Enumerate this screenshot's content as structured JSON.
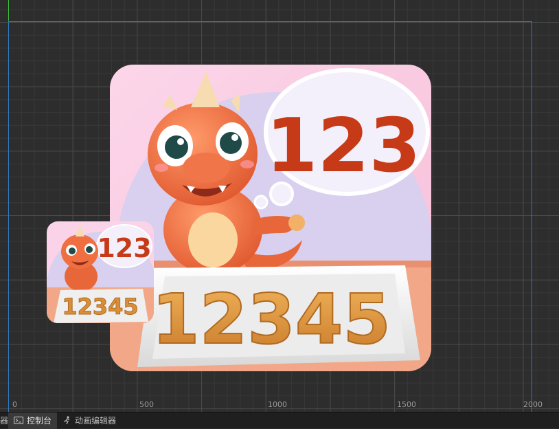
{
  "ruler": {
    "labels": [
      "0",
      "500",
      "1000",
      "1500",
      "2000"
    ]
  },
  "preview": {
    "thought_number": "123",
    "plate_digits": "12345"
  },
  "bottom_tabs": {
    "partial_label": "器",
    "console_label": "控制台",
    "animation_editor_label": "动画编辑器"
  },
  "colors": {
    "canvas_bg": "#2d2d2d",
    "frame_blue": "#2f7fc9",
    "axis_green": "#3ec13e",
    "card_pink": "#fbd3e9",
    "card_lavender": "#d8d0ee",
    "number_red": "#c63a17",
    "biscuit": "#d98f3a"
  },
  "icons": {
    "console": "terminal-icon",
    "animation": "running-figure-icon"
  }
}
